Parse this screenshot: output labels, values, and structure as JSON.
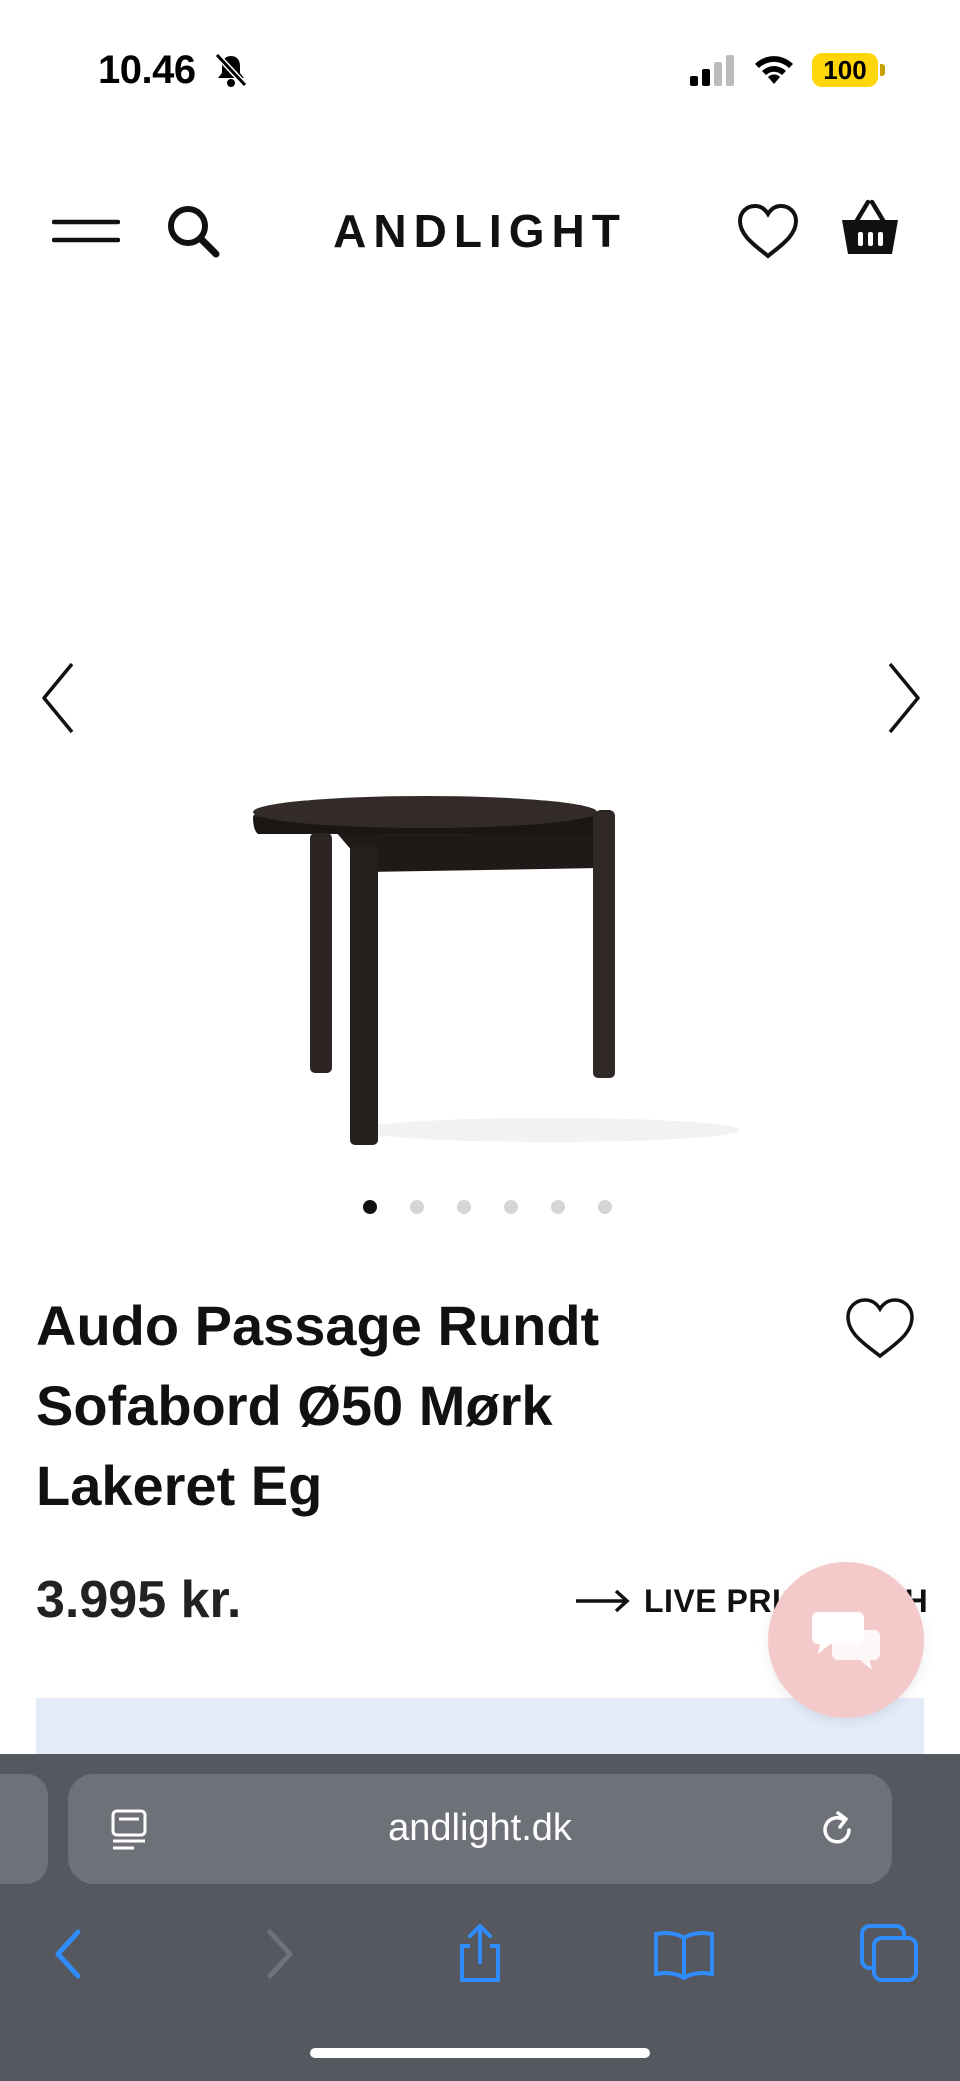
{
  "status_bar": {
    "time": "10.46",
    "battery": "100",
    "colors": {
      "battery": "#ffd60a"
    }
  },
  "header": {
    "logo": "ANDLIGHT",
    "icons": [
      "menu-icon",
      "search-icon",
      "heart-icon",
      "basket-icon"
    ]
  },
  "gallery": {
    "image_count": 6,
    "active_index": 0
  },
  "product": {
    "title_lines": [
      "Audo Passage Rundt",
      "Sofabord Ø50 Mørk",
      "Lakeret Eg"
    ],
    "price": "3.995 kr.",
    "live_link": "LIVE PRIS MATCH"
  },
  "browser": {
    "url": "andlight.dk",
    "colors": {
      "bar": "#55595f",
      "accent": "#2f8cff"
    }
  }
}
